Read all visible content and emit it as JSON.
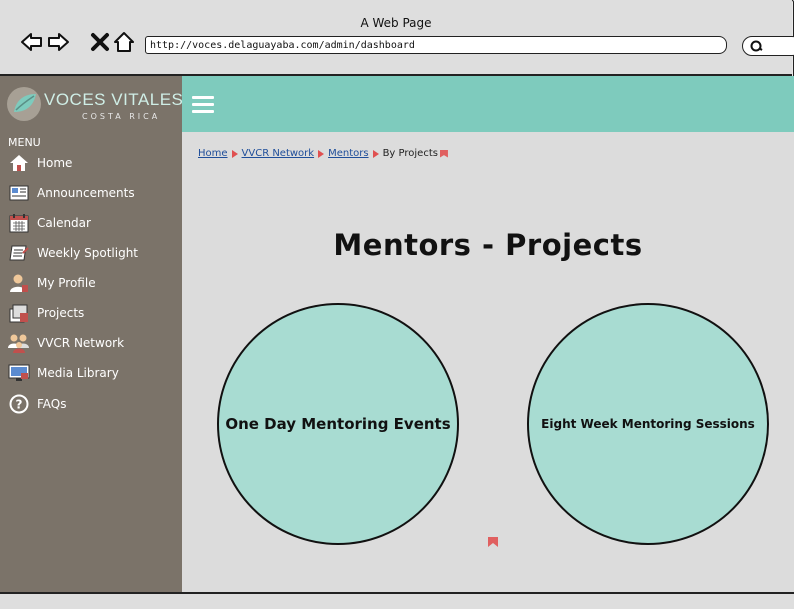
{
  "browser": {
    "window_title": "A Web Page",
    "url": "http://voces.delaguayaba.com/admin/dashboard"
  },
  "brand": {
    "name": "VOCES VITALES",
    "sub": "COSTA RICA"
  },
  "colors": {
    "header_teal": "#7ecbbd",
    "sidebar_brown": "#7b7369",
    "content_gray": "#dcdcdc",
    "circle_fill": "#a8dcd2",
    "link_blue": "#1f4e9a"
  },
  "sidebar": {
    "menu_label": "MENU",
    "items": [
      {
        "label": "Home",
        "icon": "home-icon"
      },
      {
        "label": "Announcements",
        "icon": "announcements-icon"
      },
      {
        "label": "Calendar",
        "icon": "calendar-icon"
      },
      {
        "label": "Weekly Spotlight",
        "icon": "spotlight-icon"
      },
      {
        "label": "My Profile",
        "icon": "profile-icon"
      },
      {
        "label": "Projects",
        "icon": "projects-icon"
      },
      {
        "label": "VVCR Network",
        "icon": "network-icon"
      },
      {
        "label": "Media Library",
        "icon": "media-icon"
      },
      {
        "label": "FAQs",
        "icon": "faq-icon"
      }
    ]
  },
  "breadcrumb": {
    "items": [
      "Home",
      "VVCR Network",
      "Mentors",
      "By Projects"
    ]
  },
  "main": {
    "title": "Mentors - Projects",
    "options": [
      "One Day Mentoring Events",
      "Eight Week Mentoring Sessions"
    ]
  }
}
